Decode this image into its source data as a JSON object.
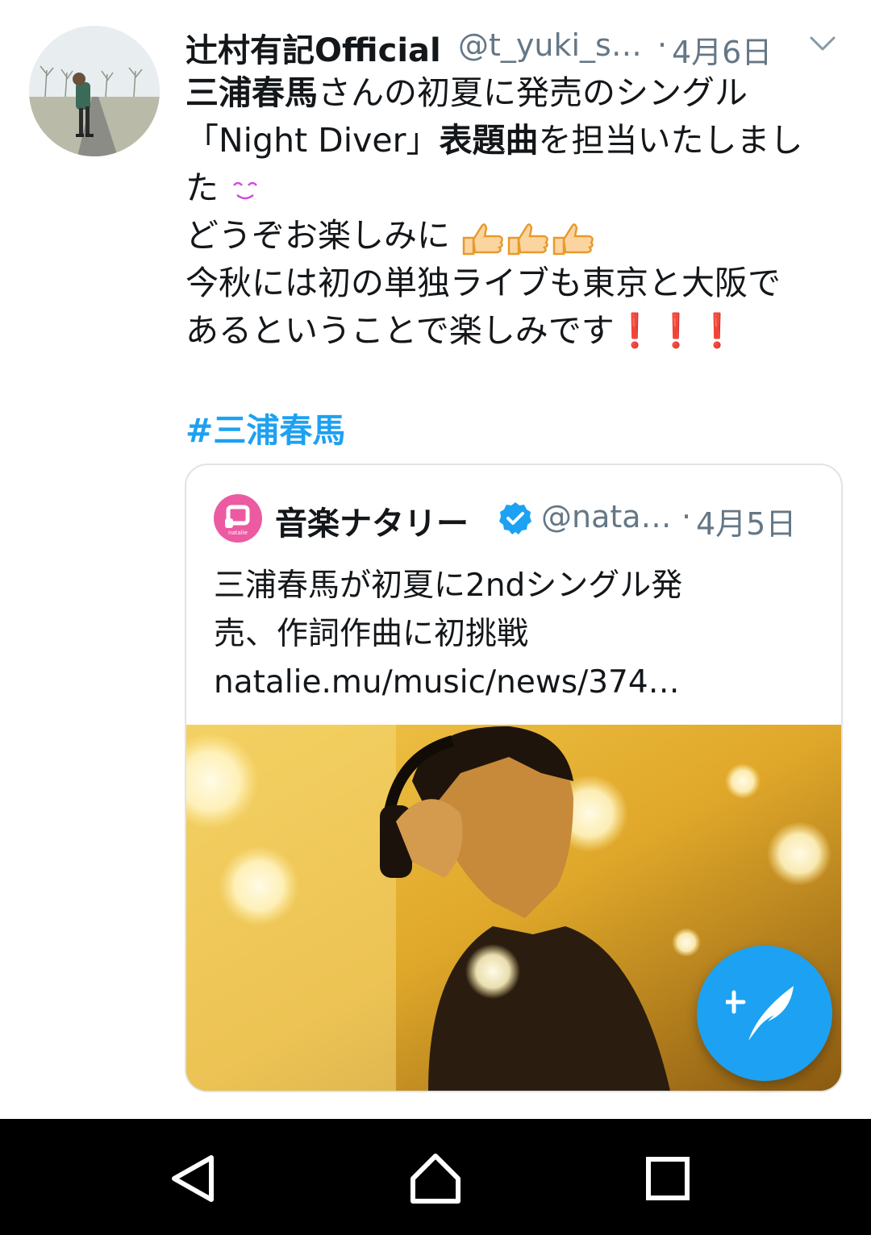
{
  "tweet": {
    "author_name": "辻村有記Official",
    "author_handle": "@t_yuki_s…",
    "separator": "·",
    "timestamp": "4月6日",
    "text_lines": [
      [
        "三浦春馬",
        "さんの初夏に発売のシングル"
      ],
      [
        "「Night Diver」",
        "表題曲",
        "を担当いたしまし"
      ],
      [
        "た"
      ],
      [
        "どうぞお楽しみに"
      ],
      [
        "今秋には初の単独ライブも東京と大阪で"
      ],
      [
        "あるということで楽しみです"
      ]
    ],
    "emojis": {
      "smile": "smiling-face-icon",
      "thumbs": "thumbs-up-icon",
      "exclaim": "❗"
    },
    "hashtag": "#三浦春馬",
    "menu_icon": "chevron-down-icon"
  },
  "quote": {
    "logo_text": "natalie",
    "name": "音楽ナタリー",
    "verified_icon": "verified-badge-icon",
    "handle": "@nata…",
    "separator": "·",
    "timestamp": "4月5日",
    "text_lines": [
      "三浦春馬が初夏に2ndシングル発",
      "売、作詞作曲に初挑戦",
      "natalie.mu/music/news/374…"
    ],
    "image": "photo-man-with-headphones"
  },
  "fab": {
    "icon": "compose-tweet-icon"
  },
  "navbar": {
    "back_icon": "back-triangle-icon",
    "home_icon": "home-icon",
    "recents_icon": "recents-square-icon"
  },
  "colors": {
    "accent": "#1da1f2",
    "secondary_text": "#657786",
    "natalie_pink": "#ec5aa2",
    "alert_red": "#e0201b"
  }
}
